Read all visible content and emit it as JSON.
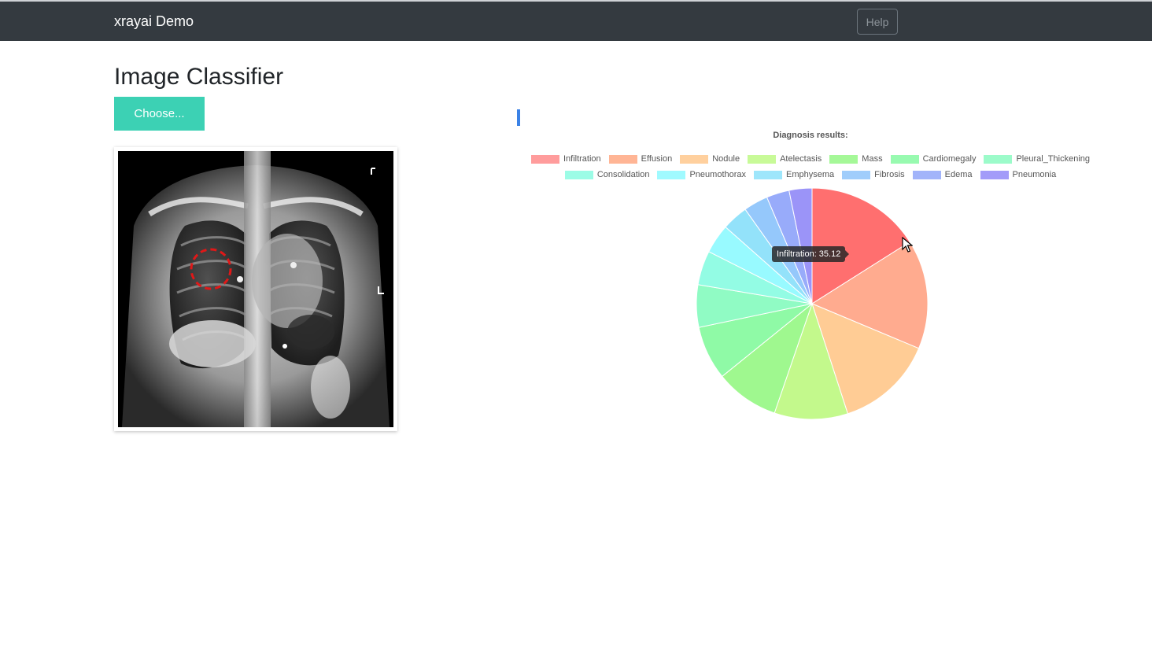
{
  "navbar": {
    "brand": "xrayai Demo",
    "help_label": "Help"
  },
  "main": {
    "title": "Image Classifier",
    "choose_label": "Choose...",
    "upload_progress": ""
  },
  "tooltip": {
    "text": "Infiltration: 35.12"
  },
  "colors": {
    "navbar_bg": "#343a40",
    "choose_button": "#3cd1b4",
    "lesion_marker": "#e01818",
    "progress_accent": "#3b82e6"
  },
  "chart_data": {
    "type": "pie",
    "title": "Diagnosis results:",
    "legend_position": "top",
    "categories": [
      "Infiltration",
      "Effusion",
      "Nodule",
      "Atelectasis",
      "Mass",
      "Cardiomegaly",
      "Pleural_Thickening",
      "Consolidation",
      "Pneumothorax",
      "Emphysema",
      "Fibrosis",
      "Edema",
      "Pneumonia"
    ],
    "values": [
      35.12,
      33.5,
      30.0,
      22.5,
      19.5,
      16.5,
      13.0,
      10.5,
      9.0,
      8.0,
      7.5,
      7.0,
      7.0
    ],
    "colors": [
      "#ff6f6f",
      "#ffab8f",
      "#ffcc95",
      "#c3f98c",
      "#9ff88f",
      "#8ffaa6",
      "#90fbc4",
      "#93fce4",
      "#98faff",
      "#93e2fa",
      "#95c8fb",
      "#98abfa",
      "#9b94f8"
    ]
  }
}
